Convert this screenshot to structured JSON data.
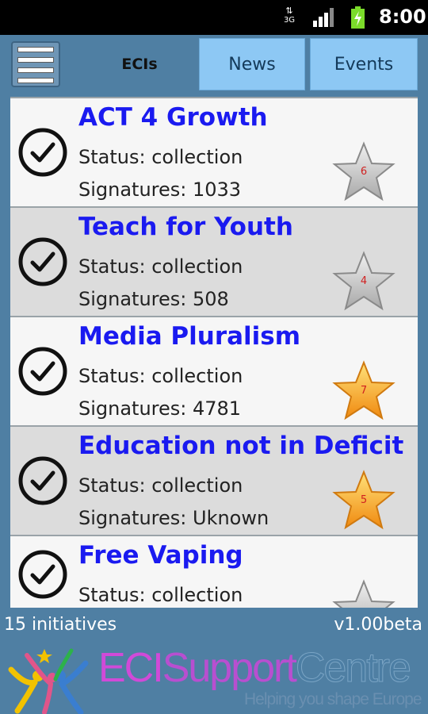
{
  "statusbar": {
    "network": "3G",
    "time": "8:00"
  },
  "toolbar": {
    "tabs": [
      {
        "label": "ECIs"
      },
      {
        "label": "News"
      },
      {
        "label": "Events"
      }
    ]
  },
  "initiatives": [
    {
      "title": "ACT 4 Growth",
      "status": "Status: collection",
      "signatures": "Signatures: 1033",
      "rating": "6",
      "starred": false
    },
    {
      "title": "Teach for Youth",
      "status": "Status: collection",
      "signatures": "Signatures: 508",
      "rating": "4",
      "starred": false
    },
    {
      "title": "Media Pluralism",
      "status": "Status: collection",
      "signatures": "Signatures: 4781",
      "rating": "7",
      "starred": true
    },
    {
      "title": "Education not in Deficit",
      "status": "Status: collection",
      "signatures": "Signatures: Uknown",
      "rating": "5",
      "starred": true
    },
    {
      "title": "Free Vaping",
      "status": "Status: collection",
      "signatures": "",
      "rating": "",
      "starred": false
    }
  ],
  "footer": {
    "count": "15 initiatives",
    "version": "v1.00beta"
  },
  "logo": {
    "part1": "ECI",
    "part2": "Support",
    "part3": "Centre",
    "tagline": "Helping you shape Europe"
  },
  "colors": {
    "background": "#4f7fa3",
    "tab_active_bg": "#8dc8f4",
    "title_blue": "#1a1af0",
    "star_gold": "#f5a623"
  }
}
